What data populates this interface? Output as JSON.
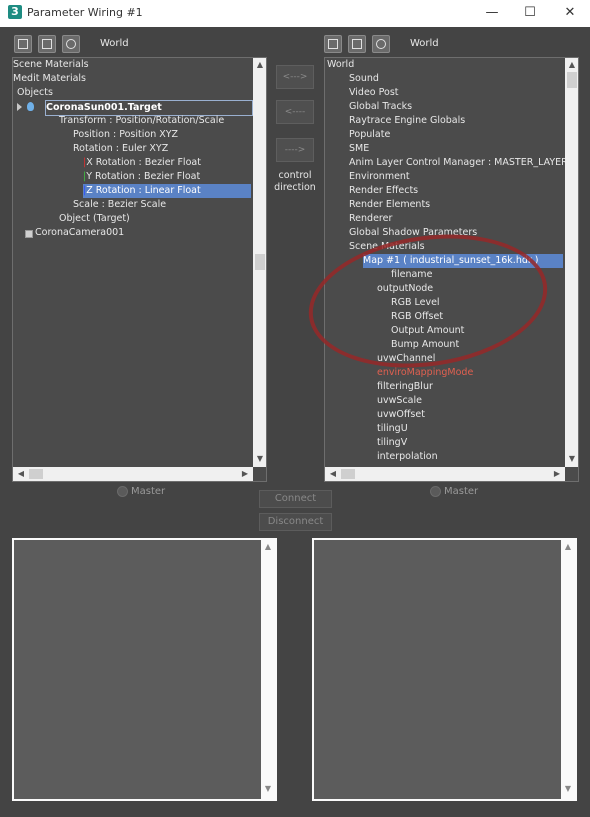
{
  "window": {
    "title": "Parameter Wiring #1",
    "app_icon": "3",
    "minimize": "—",
    "maximize": "☐",
    "close": "✕"
  },
  "left": {
    "header": "World",
    "rows": [
      "Scene Materials",
      "Medit Materials",
      "Objects",
      "CoronaSun001.Target",
      "Transform : Position/Rotation/Scale",
      "Position : Position XYZ",
      "Rotation : Euler XYZ",
      "X Rotation : Bezier Float",
      "Y Rotation : Bezier Float",
      "Z Rotation : Linear Float",
      "Scale : Bezier Scale",
      "Object (Target)",
      "CoronaCamera001"
    ],
    "master": "Master"
  },
  "middle": {
    "btn_both": "<--->",
    "btn_left": "<----",
    "btn_right": "---->",
    "control_direction": "control direction",
    "connect": "Connect",
    "disconnect": "Disconnect"
  },
  "right": {
    "header": "World",
    "rows": [
      "World",
      "Sound",
      "Video Post",
      "Global Tracks",
      "Raytrace Engine Globals",
      "Populate",
      "SME",
      "Anim Layer Control Manager : MASTER_LAYER_MA",
      "Environment",
      "Render Effects",
      "Render Elements",
      "Renderer",
      "Global Shadow Parameters",
      "Scene Materials",
      "Map #1 ( industrial_sunset_16k.hdr )",
      "filename",
      "outputNode",
      "RGB Level",
      "RGB Offset",
      "Output Amount",
      "Bump Amount",
      "uvwChannel",
      "enviroMappingMode",
      "filteringBlur",
      "uvwScale",
      "uvwOffset",
      "tilingU",
      "tilingV",
      "interpolation"
    ],
    "master": "Master"
  },
  "colors": {
    "selection": "#5a82c5",
    "highlight_red": "#e06050",
    "annotation": "#962828"
  }
}
